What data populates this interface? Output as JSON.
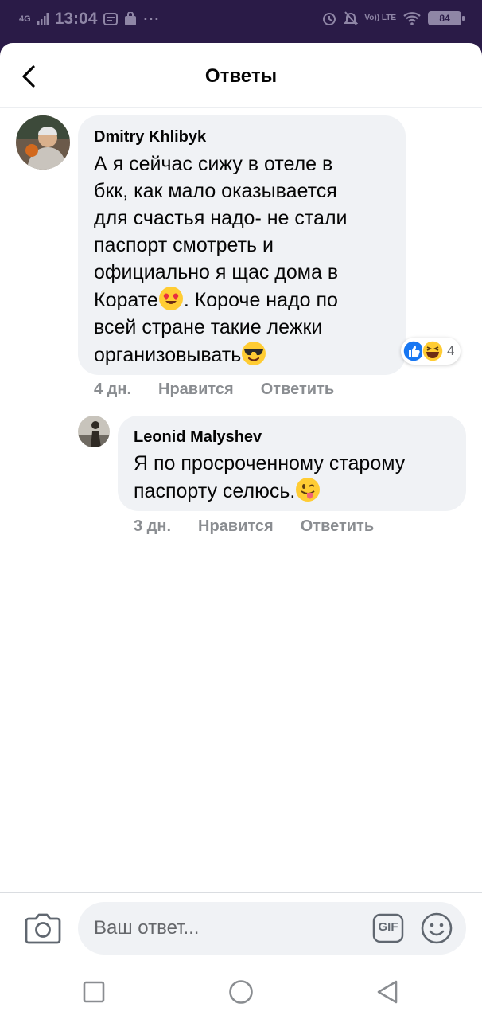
{
  "status_bar": {
    "network": "4G",
    "time": "13:04",
    "more": "···",
    "volte": "Vo)) LTE",
    "battery": "84"
  },
  "header": {
    "title": "Ответы",
    "back_icon": "chevron-left-icon"
  },
  "comment": {
    "author": "Dmitry Khlibyk",
    "lines": [
      "А я сейчас сижу в отеле в",
      "бкк, как мало оказывается",
      "для счастья надо- не стали",
      "паспорт смотреть и",
      "официально я щас дома в"
    ],
    "line6_before": "Корате",
    "line6_emoji": "heart-eyes-emoji",
    "line6_after": ". Короче надо по",
    "line7": "всей стране такие лежки",
    "line8": "организовывать",
    "line8_emoji": "sunglasses-emoji",
    "reaction_count": "4",
    "reaction_icons": [
      "like-icon",
      "haha-icon"
    ],
    "time": "4 дн.",
    "like_label": "Нравится",
    "reply_label": "Ответить"
  },
  "reply": {
    "author": "Leonid Malyshev",
    "line1": "Я по просроченному старому",
    "line2": "паспорту селюсь.",
    "line2_emoji": "winking-tongue-emoji",
    "time": "3 дн.",
    "like_label": "Нравится",
    "reply_label": "Ответить"
  },
  "composer": {
    "placeholder": "Ваш ответ...",
    "camera_icon": "camera-icon",
    "gif_label": "GIF",
    "emoji_icon": "smiley-icon"
  },
  "nav": {
    "recents_icon": "square-icon",
    "home_icon": "circle-icon",
    "back_icon": "triangle-back-icon"
  },
  "colors": {
    "status_bar_bg": "#2a1b47",
    "bubble_bg": "#f0f2f5",
    "meta_text": "#8a8d91",
    "like_blue": "#1877f2"
  }
}
